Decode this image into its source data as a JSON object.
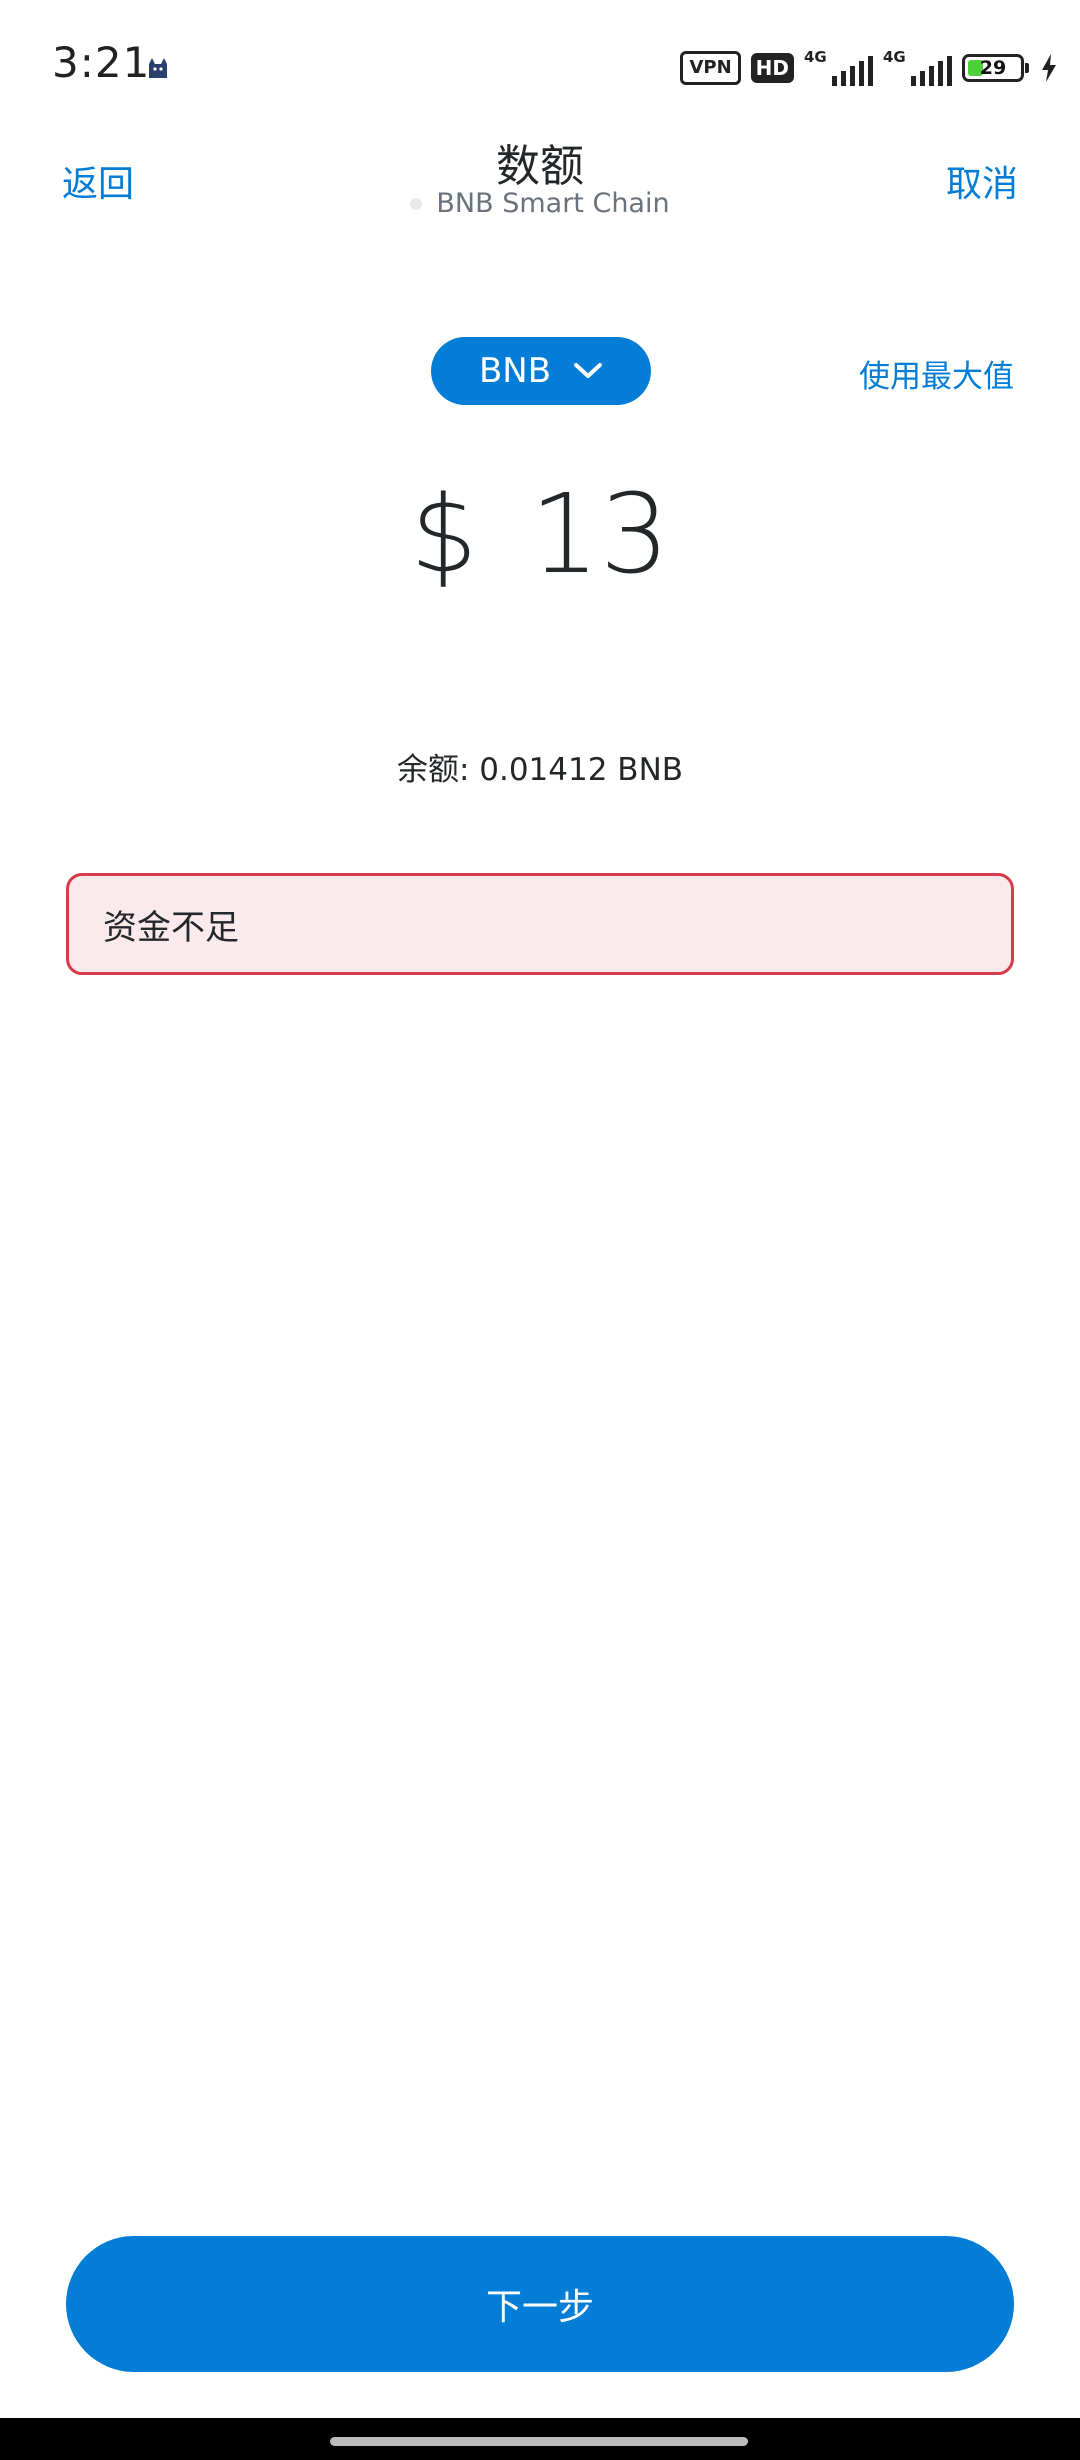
{
  "status_bar": {
    "time": "3:21",
    "vpn": "VPN",
    "hd": "HD",
    "sim1_type": "4G",
    "sim2_type": "4G",
    "battery_level": "29",
    "battery_fraction": 0.29,
    "icons": [
      "cat-icon",
      "vpn-badge",
      "hd-badge",
      "signal-icon",
      "signal-icon",
      "battery-icon",
      "charging-bolt-icon"
    ]
  },
  "header": {
    "back_label": "返回",
    "title": "数额",
    "network": "BNB Smart Chain",
    "cancel_label": "取消"
  },
  "token_selector": {
    "symbol": "BNB",
    "icon": "chevron-down-icon",
    "use_max_label": "使用最大值"
  },
  "amount": {
    "currency_symbol": "$",
    "value": "13"
  },
  "balance": {
    "text": "余额: 0.01412 BNB"
  },
  "error": {
    "message": "资金不足"
  },
  "footer": {
    "next_label": "下一步"
  },
  "colors": {
    "accent": "#037dd6",
    "error_border": "#d73a49",
    "error_background": "#fbeaeb",
    "text": "#24272a",
    "muted": "#6a737d"
  }
}
